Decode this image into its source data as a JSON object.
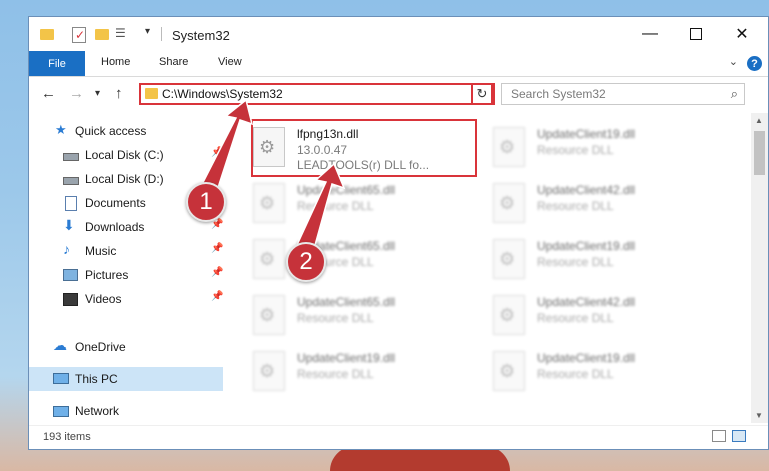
{
  "window": {
    "title": "System32"
  },
  "ribbon": {
    "tabs": [
      "File",
      "Home",
      "Share",
      "View"
    ],
    "help": "?"
  },
  "nav": {
    "address": "C:\\Windows\\System32",
    "search_placeholder": "Search System32"
  },
  "sidebar": {
    "items": [
      {
        "label": "Quick access",
        "icon": "star-icon",
        "pinned": false
      },
      {
        "label": "Local Disk (C:)",
        "icon": "drive-icon",
        "pinned": true
      },
      {
        "label": "Local Disk (D:)",
        "icon": "drive-icon",
        "pinned": true
      },
      {
        "label": "Documents",
        "icon": "documents-icon",
        "pinned": true
      },
      {
        "label": "Downloads",
        "icon": "download-icon",
        "pinned": true
      },
      {
        "label": "Music",
        "icon": "music-icon",
        "pinned": true
      },
      {
        "label": "Pictures",
        "icon": "pictures-icon",
        "pinned": true
      },
      {
        "label": "Videos",
        "icon": "videos-icon",
        "pinned": true
      },
      {
        "label": "OneDrive",
        "icon": "cloud-icon",
        "pinned": false
      },
      {
        "label": "This PC",
        "icon": "computer-icon",
        "pinned": false,
        "selected": true
      },
      {
        "label": "Network",
        "icon": "network-icon",
        "pinned": false
      }
    ]
  },
  "files": {
    "selected": {
      "name": "lfpng13n.dll",
      "version": "13.0.0.47",
      "description": "LEADTOOLS(r) DLL fo..."
    },
    "others": [
      {
        "name": "UpdateClient19.dll",
        "type": "Resource DLL"
      },
      {
        "name": "UpdateClient65.dll",
        "type": "Resource DLL"
      },
      {
        "name": "UpdateClient42.dll",
        "type": "Resource DLL"
      },
      {
        "name": "UpdateClient65.dll",
        "type": "Resource DLL"
      },
      {
        "name": "UpdateClient19.dll",
        "type": "Resource DLL"
      },
      {
        "name": "UpdateClient65.dll",
        "type": "Resource DLL"
      },
      {
        "name": "UpdateClient42.dll",
        "type": "Resource DLL"
      },
      {
        "name": "UpdateClient19.dll",
        "type": "Resource DLL"
      },
      {
        "name": "UpdateClient19.dll",
        "type": "Resource DLL"
      }
    ]
  },
  "status": {
    "item_count": "193 items"
  },
  "callouts": [
    "1",
    "2"
  ],
  "colors": {
    "accent": "#1a6fc4",
    "highlight": "#d9343a",
    "badge": "#c6323a",
    "selection": "#cce4f7"
  }
}
